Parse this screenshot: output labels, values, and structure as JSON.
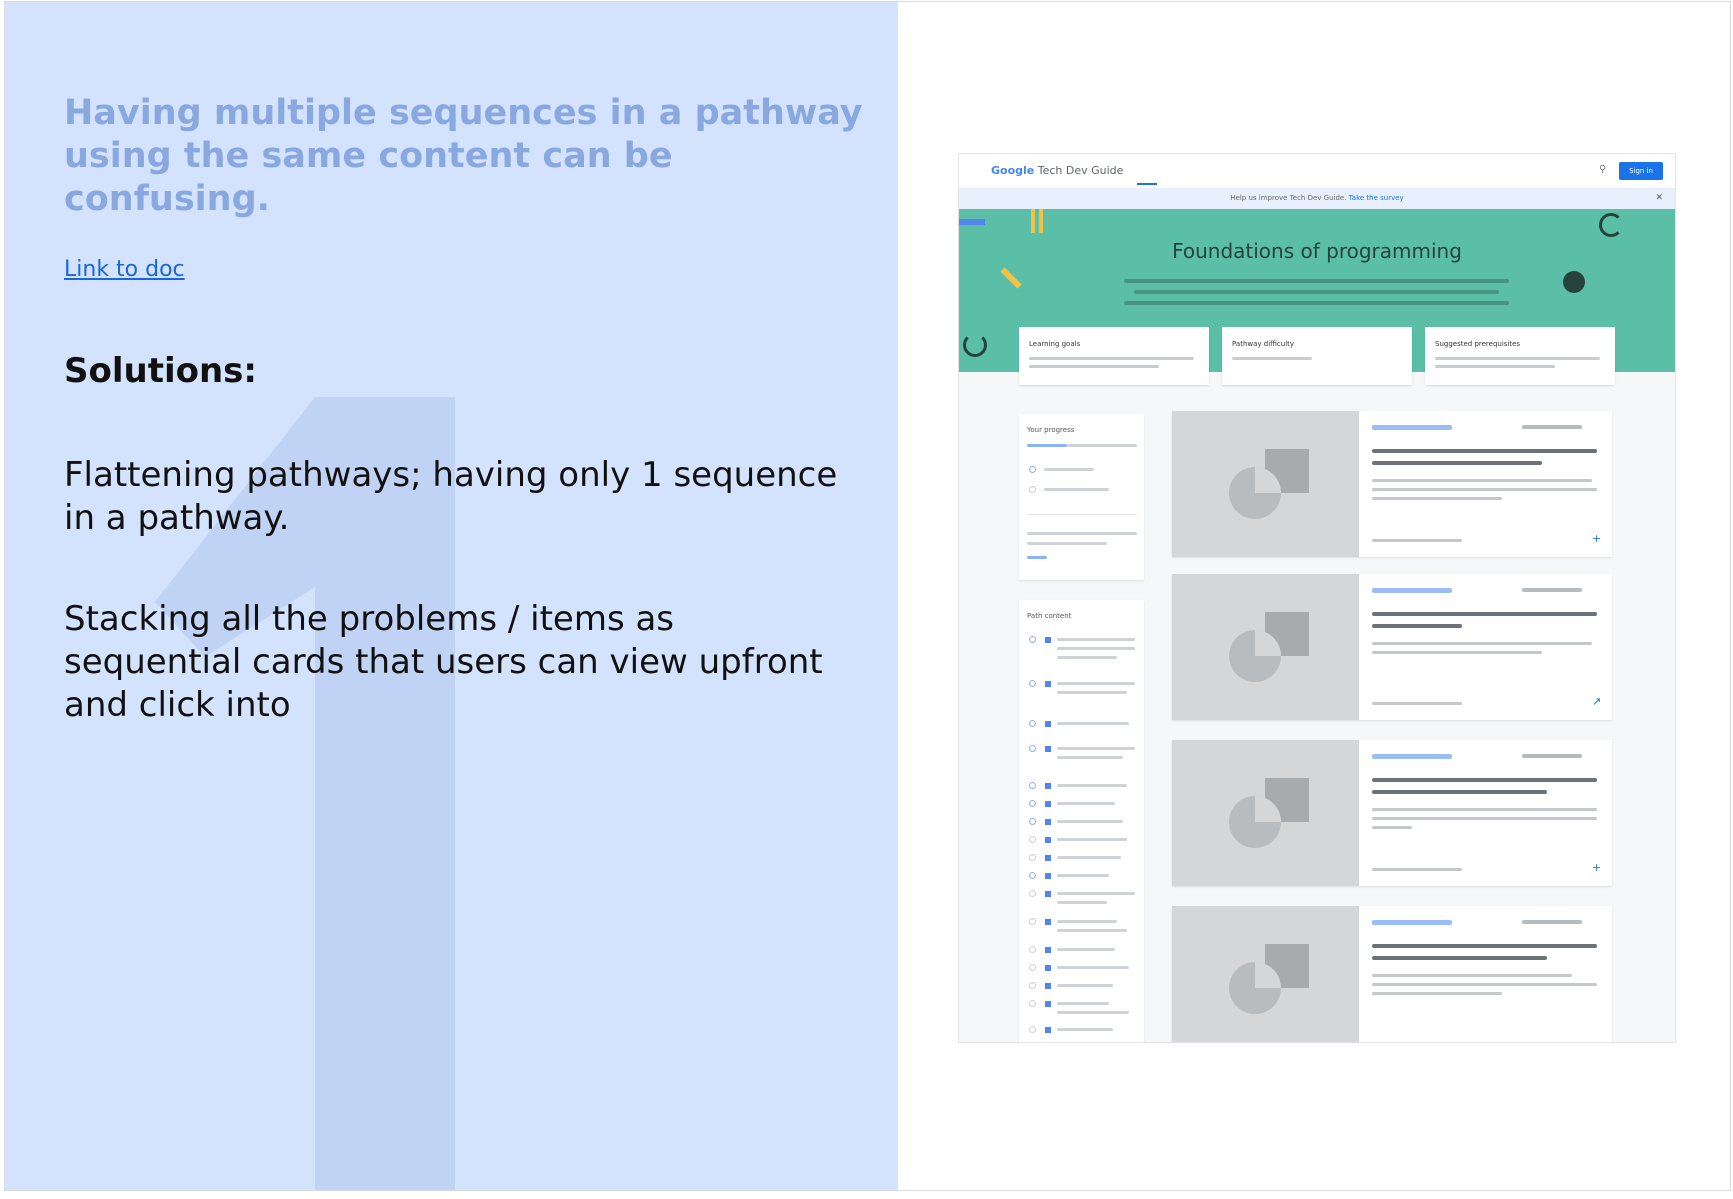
{
  "slide": {
    "headline": "Having multiple sequences in a pathway using the same content can be confusing.",
    "link_label": "Link to doc",
    "solutions_title": "Solutions:",
    "solutions": [
      "Flattening pathways; having only 1 sequence in a pathway.",
      "Stacking all the problems / items as sequential cards that users can view upfront and click into"
    ]
  },
  "preview": {
    "logo_google": "Google",
    "logo_product": "Tech Dev Guide",
    "sign_in": "Sign in",
    "banner_text": "Help us improve Tech Dev Guide.",
    "banner_link": "Take the survey",
    "hero_title": "Foundations of programming",
    "info_cards": [
      "Learning goals",
      "Pathway difficulty",
      "Suggested prerequisites"
    ],
    "progress_label": "Your progress",
    "content_label": "Path content"
  },
  "colors": {
    "panel_bg": "#d3e3fd",
    "headline": "#8aa8e0",
    "numeral": "#c0d3f4",
    "link": "#1a66d8",
    "hero": "#5bbfa7"
  }
}
